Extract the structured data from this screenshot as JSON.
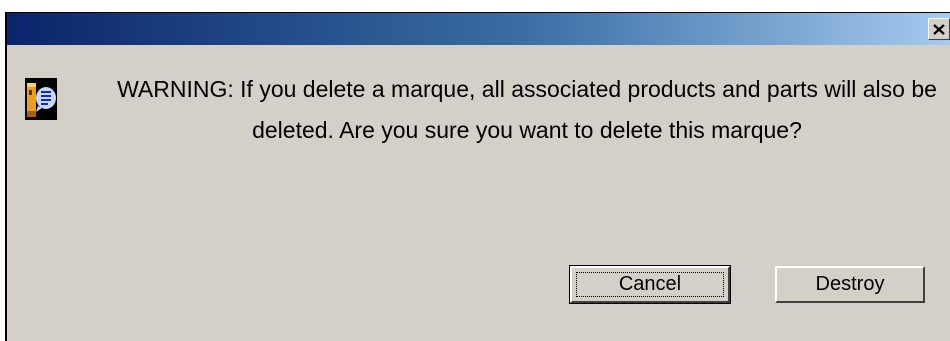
{
  "dialog": {
    "title": "",
    "close_icon": "close-icon",
    "message_icon": "message-icon",
    "message": "WARNING:  If you delete a marque, all associated products and parts will also be deleted. Are you sure you want to delete this marque?",
    "buttons": {
      "cancel_label": "Cancel",
      "destroy_label": "Destroy"
    }
  },
  "colors": {
    "title_gradient_start": "#0a246a",
    "title_gradient_end": "#a6caf0",
    "dialog_background": "#d4d0c8"
  }
}
